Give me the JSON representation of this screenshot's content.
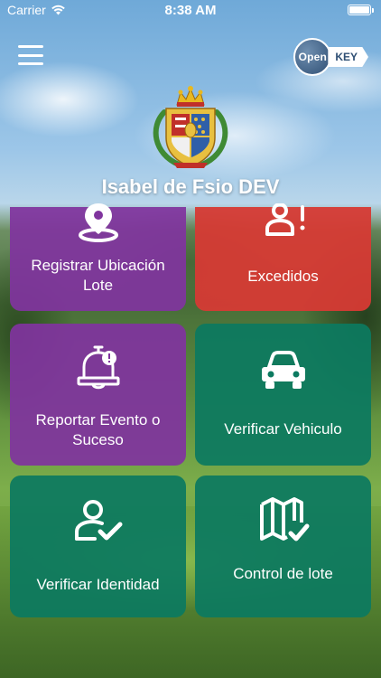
{
  "status_bar": {
    "carrier": "Carrier",
    "time": "8:38 AM"
  },
  "header": {
    "menu_icon": "hamburger-menu-icon",
    "logo_left": "Open",
    "logo_right": "KEY",
    "title": "Isabel de Fsio DEV"
  },
  "tiles": [
    {
      "label": "Registrar Ubicación Lote",
      "icon": "location-pin-icon",
      "color": "#80349e"
    },
    {
      "label": "Excedidos",
      "icon": "person-alert-icon",
      "color": "#d63a34"
    },
    {
      "label": "Reportar Evento o Suceso",
      "icon": "bell-alert-icon",
      "color": "#80349e"
    },
    {
      "label": "Verificar Vehiculo",
      "icon": "car-icon",
      "color": "#0c7a60"
    },
    {
      "label": "Verificar Identidad",
      "icon": "person-check-icon",
      "color": "#0c7a60"
    },
    {
      "label": "Control de lote",
      "icon": "map-check-icon",
      "color": "#0c7a60"
    }
  ]
}
